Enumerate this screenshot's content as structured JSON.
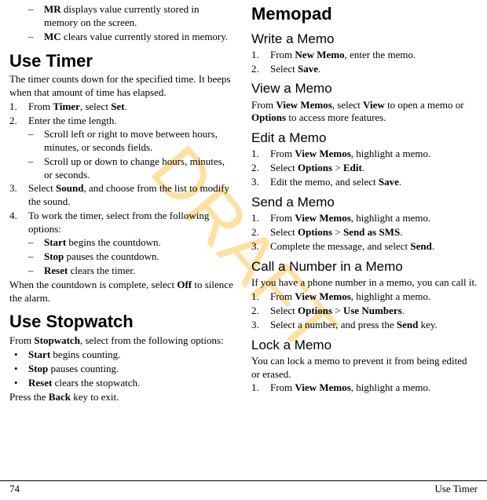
{
  "watermark": "DRAFT",
  "left": {
    "mr_label": "MR",
    "mr_text": " displays value currently stored in memory on the screen.",
    "mc_label": "MC",
    "mc_text": " clears value currently stored in memory.",
    "use_timer_heading": "Use Timer",
    "timer_intro": "The timer counts down for the specified time. It beeps when that amount of time has elapsed.",
    "timer_step1_pre": "From ",
    "timer_step1_b1": "Timer",
    "timer_step1_mid": ", select ",
    "timer_step1_b2": "Set",
    "timer_step1_post": ".",
    "timer_step2": "Enter the time length.",
    "timer_step2a": "Scroll left or right to move between hours, minutes, or seconds fields.",
    "timer_step2b": "Scroll up or down to change hours, minutes, or seconds.",
    "timer_step3_pre": "Select ",
    "timer_step3_b": "Sound",
    "timer_step3_post": ", and choose from the list to modify the sound.",
    "timer_step4": "To work the timer, select from the following options:",
    "timer_step4a_b": "Start",
    "timer_step4a_t": " begins the countdown.",
    "timer_step4b_b": "Stop",
    "timer_step4b_t": " pauses the countdown.",
    "timer_step4c_b": "Reset",
    "timer_step4c_t": " clears the timer.",
    "timer_end_pre": "When the countdown is complete, select ",
    "timer_end_b": "Off",
    "timer_end_post": " to silence the alarm.",
    "stopwatch_heading": "Use Stopwatch",
    "sw_intro_pre": "From ",
    "sw_intro_b": "Stopwatch",
    "sw_intro_post": ", select from the following options:",
    "sw_a_b": "Start",
    "sw_a_t": " begins counting.",
    "sw_b_b": "Stop",
    "sw_b_t": " pauses counting.",
    "sw_c_b": "Reset",
    "sw_c_t": " clears the stopwatch.",
    "sw_end_pre": "Press the ",
    "sw_end_b": "Back",
    "sw_end_post": " key to exit."
  },
  "right": {
    "memopad_heading": "Memopad",
    "write_heading": "Write a Memo",
    "write1_pre": "From ",
    "write1_b": "New Memo",
    "write1_post": ", enter the memo.",
    "write2_pre": "Select ",
    "write2_b": "Save",
    "write2_post": ".",
    "view_heading": "View a Memo",
    "view_pre": "From ",
    "view_b1": "View Memos",
    "view_mid1": ", select ",
    "view_b2": "View",
    "view_mid2": " to open a memo or ",
    "view_b3": "Options",
    "view_post": " to access more features.",
    "edit_heading": "Edit a Memo",
    "edit1_pre": "From ",
    "edit1_b": "View Memos",
    "edit1_post": ", highlight a memo.",
    "edit2_pre": "Select ",
    "edit2_b1": "Options",
    "edit2_mid": " > ",
    "edit2_b2": "Edit",
    "edit2_post": ".",
    "edit3_pre": "Edit the memo, and select ",
    "edit3_b": "Save",
    "edit3_post": ".",
    "send_heading": "Send a Memo",
    "send1_pre": "From ",
    "send1_b": "View Memos",
    "send1_post": ", highlight a memo.",
    "send2_pre": "Select ",
    "send2_b1": "Options",
    "send2_mid": " > ",
    "send2_b2": "Send as SMS",
    "send2_post": ".",
    "send3_pre": "Complete the message, and select ",
    "send3_b": "Send",
    "send3_post": ".",
    "call_heading": "Call a Number in a Memo",
    "call_intro": "If you have a phone number in a memo, you can call it.",
    "call1_pre": "From ",
    "call1_b": "View Memos",
    "call1_post": ", highlight a memo.",
    "call2_pre": "Select ",
    "call2_b1": "Options",
    "call2_mid": " > ",
    "call2_b2": "Use Numbers",
    "call2_post": ".",
    "call3_pre": "Select a number, and press the ",
    "call3_b": "Send",
    "call3_post": " key.",
    "lock_heading": "Lock a Memo",
    "lock_intro": "You can lock a memo to prevent it from being edited or erased.",
    "lock1_pre": "From ",
    "lock1_b": "View Memos",
    "lock1_post": ", highlight a memo."
  },
  "footer": {
    "page_num": "74",
    "section": "Use Timer"
  }
}
